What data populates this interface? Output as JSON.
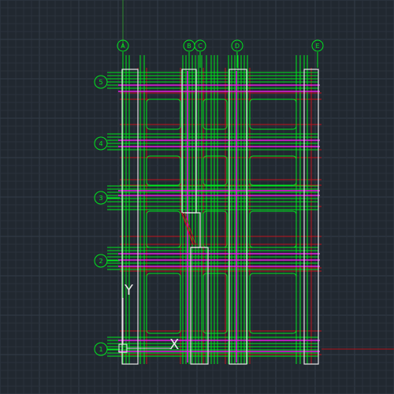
{
  "drawing": {
    "background": "#212830",
    "grid_minor_color": "#2a323c",
    "grid_major_color": "#323c47",
    "colors": {
      "green": "#00e61e",
      "magenta": "#e41be4",
      "red": "#c0141e",
      "white": "#e6e6e6",
      "yellow": "#e6e628",
      "axis_red": "#b01018"
    },
    "top_grid_labels": [
      "A",
      "B",
      "C",
      "D",
      "E"
    ],
    "left_grid_labels": [
      "5",
      "4",
      "3",
      "2",
      "1"
    ],
    "ucs_icon": {
      "x_label": "X",
      "y_label": "Y"
    }
  }
}
